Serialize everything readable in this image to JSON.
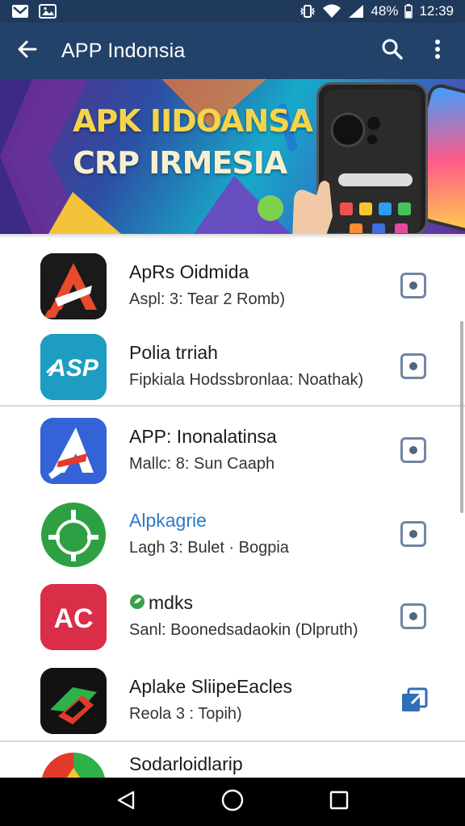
{
  "status_bar": {
    "battery": "48%",
    "time": "12:39"
  },
  "app_bar": {
    "title": "APP Indonsia",
    "back_icon": "arrow-left-icon",
    "search_icon": "search-icon",
    "menu_icon": "more-vert-icon"
  },
  "banner": {
    "line1": "APK IIDOANSA",
    "line2": "CRP IRMESIA"
  },
  "apps": [
    {
      "name": "ApRs Oidmida",
      "subtitle": "Aspl: 3: Tear 2 Romb)",
      "icon": "red-arrow-a-icon",
      "action_icon": "install-icon",
      "name_color": "#1b1b1b"
    },
    {
      "name": "Polia trriah",
      "subtitle": "Fipkiala Hodssbronlaa: Noathak)",
      "icon": "asp-logo-icon",
      "action_icon": "install-icon",
      "name_color": "#1b1b1b"
    },
    {
      "name": "APP: Inonalatinsa",
      "subtitle": "Mallc: 8: Sun Caaph",
      "icon": "blue-a-logo-icon",
      "action_icon": "install-icon",
      "name_color": "#1b1b1b"
    },
    {
      "name": "Alpkagrie",
      "subtitle": "Lagh 3: Bulet · Bogpia",
      "icon": "android-target-icon",
      "action_icon": "install-icon",
      "name_color": "#2a79c8"
    },
    {
      "name": "mdks",
      "subtitle": "Sanl: Boonedsadaokin (Dlpruth)",
      "icon": "ac-logo-icon",
      "action_icon": "download-icon",
      "name_color": "#1b1b1b"
    },
    {
      "name": "Aplake SliipeEacles",
      "subtitle": "Reola 3 : Topih)",
      "icon": "green-red-arrow-icon",
      "action_icon": "open-icon",
      "name_color": "#1b1b1b"
    },
    {
      "name": "Sodarloidlarip",
      "subtitle": "",
      "icon": "colorful-partial-icon",
      "action_icon": "",
      "name_color": "#1b1b1b"
    }
  ],
  "nav": {
    "back": "nav-back-icon",
    "home": "nav-home-icon",
    "recents": "nav-recents-icon"
  }
}
